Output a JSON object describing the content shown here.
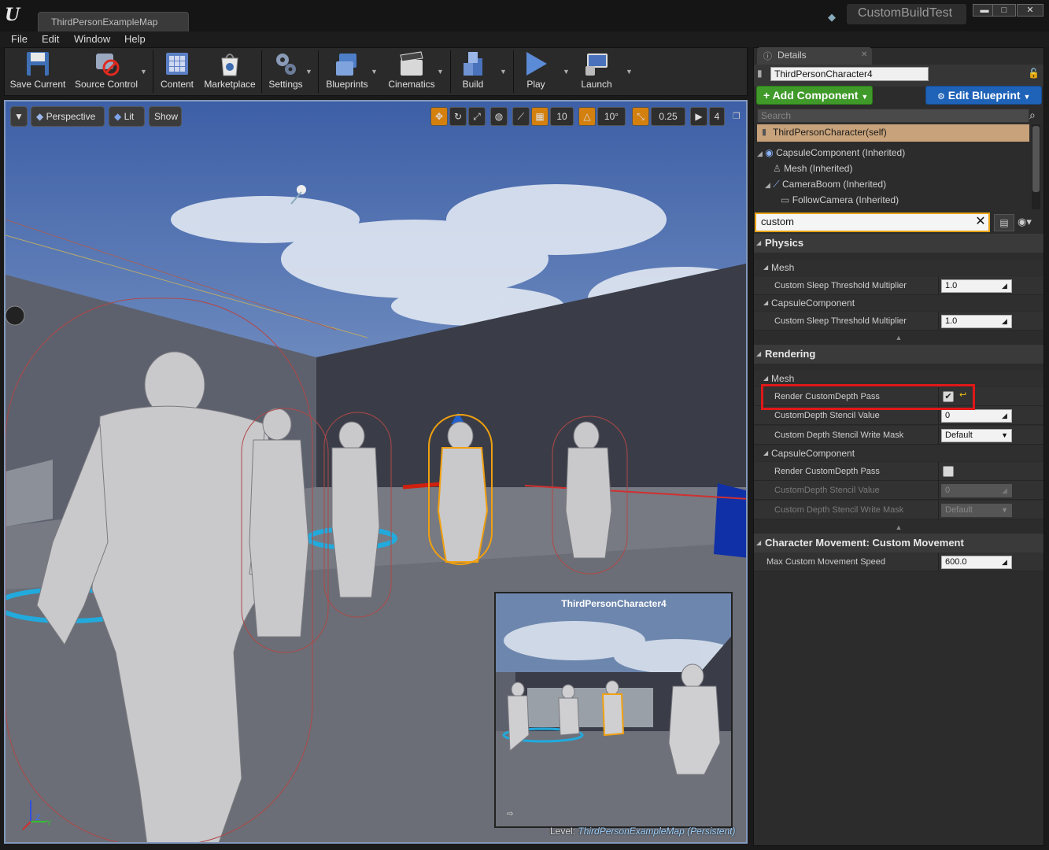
{
  "window": {
    "map_tab": "ThirdPersonExampleMap",
    "project": "CustomBuildTest",
    "minimize": "▬",
    "maximize": "□",
    "close": "✕"
  },
  "menu": [
    "File",
    "Edit",
    "Window",
    "Help"
  ],
  "toolbar": [
    {
      "label": "Save Current",
      "icon": "save-icon"
    },
    {
      "label": "Source Control",
      "icon": "source-control-icon"
    },
    {
      "label": "Content",
      "icon": "content-icon"
    },
    {
      "label": "Marketplace",
      "icon": "marketplace-icon"
    },
    {
      "label": "Settings",
      "icon": "settings-icon"
    },
    {
      "label": "Blueprints",
      "icon": "blueprints-icon"
    },
    {
      "label": "Cinematics",
      "icon": "cinematics-icon"
    },
    {
      "label": "Build",
      "icon": "build-icon"
    },
    {
      "label": "Play",
      "icon": "play-icon"
    },
    {
      "label": "Launch",
      "icon": "launch-icon"
    }
  ],
  "viewport": {
    "view_mode": "Perspective",
    "lighting": "Lit",
    "show": "Show",
    "grid_snap": "10",
    "rotation_snap": "10°",
    "scale_snap": "0.25",
    "camera_speed": "4",
    "preview_title": "ThirdPersonCharacter4",
    "level_prefix": "Level:",
    "level_name": "ThirdPersonExampleMap (Persistent)",
    "axis_z": "Z",
    "axis_y": "Y"
  },
  "details": {
    "tab": "Details",
    "actor_name": "ThirdPersonCharacter4",
    "add_component": "Add Component",
    "edit_blueprint": "Edit Blueprint",
    "search_placeholder": "Search",
    "tree": {
      "self": "ThirdPersonCharacter(self)",
      "capsule": "CapsuleComponent (Inherited)",
      "mesh": "Mesh (Inherited)",
      "camera_boom": "CameraBoom (Inherited)",
      "follow_camera": "FollowCamera (Inherited)"
    },
    "filter_value": "custom",
    "physics": {
      "title": "Physics",
      "mesh_sub": "Mesh",
      "mesh_prop": "Custom Sleep Threshold Multiplier",
      "mesh_value": "1.0",
      "capsule_sub": "CapsuleComponent",
      "capsule_prop": "Custom Sleep Threshold Multiplier",
      "capsule_value": "1.0"
    },
    "rendering": {
      "title": "Rendering",
      "mesh_sub": "Mesh",
      "render_pass": "Render CustomDepth Pass",
      "render_pass_checked": true,
      "stencil_value_label": "CustomDepth Stencil Value",
      "stencil_value": "0",
      "stencil_mask_label": "Custom Depth Stencil Write Mask",
      "stencil_mask": "Default",
      "capsule_sub": "CapsuleComponent",
      "cap_render_pass": "Render CustomDepth Pass",
      "cap_render_pass_checked": false,
      "cap_stencil_value_label": "CustomDepth Stencil Value",
      "cap_stencil_value": "0",
      "cap_stencil_mask_label": "Custom Depth Stencil Write Mask",
      "cap_stencil_mask": "Default"
    },
    "movement": {
      "title": "Character Movement: Custom Movement",
      "prop": "Max Custom Movement Speed",
      "value": "600.0"
    }
  },
  "colors": {
    "add_component": "#3f9a2a",
    "edit_blueprint": "#1f63b8",
    "highlight": "#e01818",
    "filter_border": "#e8a317",
    "selection_outline": "#f0a010"
  }
}
